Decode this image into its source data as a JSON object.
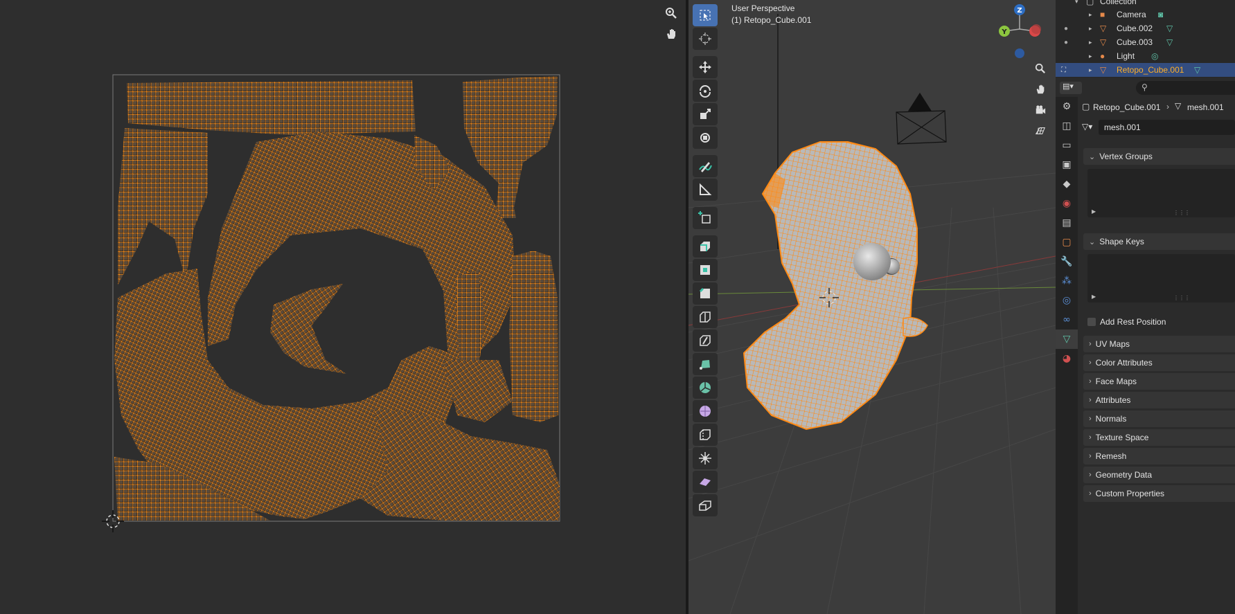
{
  "colors": {
    "uv_background": "#2e2e2e",
    "uv_island": "#f08a1c",
    "uv_vertex": "#ff8f1a",
    "uv_bounds": "#7a7a7a",
    "viewport_background": "#3c3c3c",
    "mesh_wire": "#ff8a14",
    "mesh_surface": "#b9b9b9",
    "selected_row": "#334d80",
    "selected_text": "#ffaf29",
    "active_tool": "#4772b3"
  },
  "uv_editor": {
    "nav": [
      "zoom-icon",
      "hand-pan-icon"
    ],
    "cursor_icon": "2d-cursor-icon"
  },
  "viewport": {
    "title": "User Perspective",
    "object_label": "(1) Retopo_Cube.001",
    "tools": [
      "select-box-icon",
      "cursor-icon",
      "move-icon",
      "rotate-icon",
      "scale-icon",
      "transform-icon",
      "annotate-icon",
      "measure-icon",
      "add-cube-icon",
      "extrude-region-icon",
      "inset-faces-icon",
      "bevel-icon",
      "loop-cut-icon",
      "knife-icon",
      "poly-build-icon",
      "spin-icon",
      "smooth-icon",
      "edge-slide-icon",
      "shrink-fatten-icon",
      "shear-icon",
      "rip-region-icon"
    ],
    "gizmo_axes": [
      "X",
      "Y",
      "Z"
    ],
    "nav_buttons": [
      "zoom-icon",
      "hand-pan-icon",
      "camera-icon",
      "grid-icon"
    ]
  },
  "outliner": {
    "collection": "Collection",
    "items": [
      {
        "name": "Camera",
        "icon": "camera-object-icon",
        "data_icon": "camera-data-icon",
        "visible": false,
        "selected": false
      },
      {
        "name": "Cube.002",
        "icon": "mesh-object-icon",
        "data_icon": "mesh-data-icon",
        "visible": true,
        "selected": false
      },
      {
        "name": "Cube.003",
        "icon": "mesh-object-icon",
        "data_icon": "mesh-data-icon",
        "visible": true,
        "selected": false
      },
      {
        "name": "Light",
        "icon": "light-object-icon",
        "data_icon": "light-data-icon",
        "visible": false,
        "selected": false
      },
      {
        "name": "Retopo_Cube.001",
        "icon": "mesh-object-icon",
        "data_icon": "mesh-data-icon",
        "visible": true,
        "selected": true
      }
    ]
  },
  "properties": {
    "search_placeholder": "",
    "breadcrumb_object": "Retopo_Cube.001",
    "breadcrumb_mesh": "mesh.001",
    "mesh_name": "mesh.001",
    "panels": {
      "vertex_groups": "Vertex Groups",
      "shape_keys": "Shape Keys",
      "add_rest_position": "Add Rest Position",
      "uv_maps": "UV Maps",
      "color_attributes": "Color Attributes",
      "face_maps": "Face Maps",
      "attributes": "Attributes",
      "normals": "Normals",
      "texture_space": "Texture Space",
      "remesh": "Remesh",
      "geometry_data": "Geometry Data",
      "custom_properties": "Custom Properties"
    },
    "tabs": [
      "tool-icon",
      "render-icon",
      "output-icon",
      "view-layer-icon",
      "scene-icon",
      "world-icon",
      "collection-icon",
      "object-icon",
      "modifier-icon",
      "particles-icon",
      "physics-icon",
      "constraints-icon",
      "mesh-data-icon",
      "material-icon"
    ],
    "active_tab": "mesh-data-icon"
  }
}
